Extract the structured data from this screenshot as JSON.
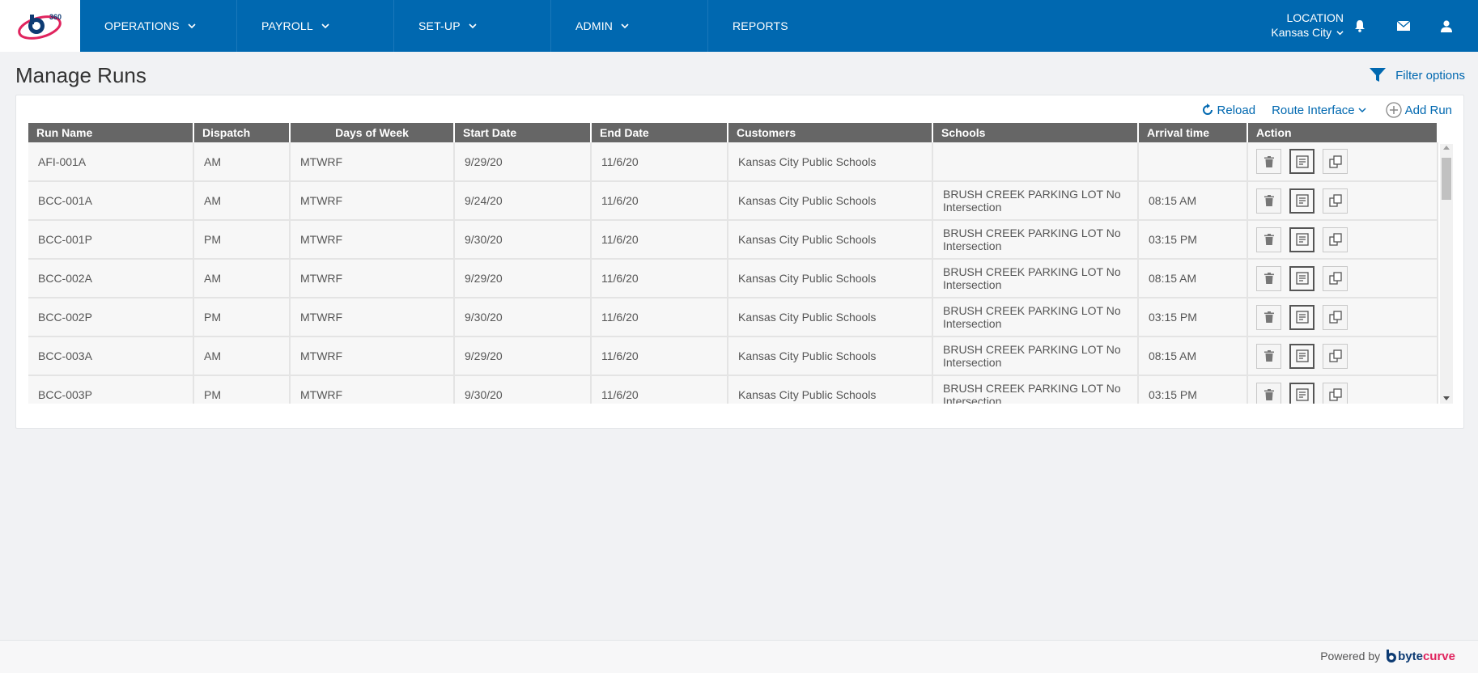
{
  "nav": {
    "logo_text": "360",
    "items": [
      {
        "label": "OPERATIONS",
        "has_dropdown": true
      },
      {
        "label": "PAYROLL",
        "has_dropdown": true
      },
      {
        "label": "SET-UP",
        "has_dropdown": true
      },
      {
        "label": "ADMIN",
        "has_dropdown": true
      },
      {
        "label": "REPORTS",
        "has_dropdown": false
      }
    ],
    "location_label": "LOCATION",
    "location_value": "Kansas City",
    "icons": [
      "bell-icon",
      "envelope-icon",
      "user-icon"
    ]
  },
  "page": {
    "title": "Manage Runs",
    "filter_label": "Filter options"
  },
  "toolbar": {
    "reload_label": "Reload",
    "route_interface_label": "Route Interface",
    "add_run_label": "Add Run"
  },
  "table": {
    "columns": [
      "Run Name",
      "Dispatch",
      "Days of Week",
      "Start Date",
      "End Date",
      "Customers",
      "Schools",
      "Arrival time",
      "Action"
    ],
    "rows": [
      {
        "run_name": "AFI-001A",
        "dispatch": "AM",
        "days": "MTWRF",
        "start": "9/29/20",
        "end": "11/6/20",
        "customer": "Kansas City Public Schools",
        "school": "",
        "arrival": ""
      },
      {
        "run_name": "BCC-001A",
        "dispatch": "AM",
        "days": "MTWRF",
        "start": "9/24/20",
        "end": "11/6/20",
        "customer": "Kansas City Public Schools",
        "school": "BRUSH CREEK PARKING LOT No Intersection",
        "arrival": "08:15 AM"
      },
      {
        "run_name": "BCC-001P",
        "dispatch": "PM",
        "days": "MTWRF",
        "start": "9/30/20",
        "end": "11/6/20",
        "customer": "Kansas City Public Schools",
        "school": "BRUSH CREEK PARKING LOT No Intersection",
        "arrival": "03:15 PM"
      },
      {
        "run_name": "BCC-002A",
        "dispatch": "AM",
        "days": "MTWRF",
        "start": "9/29/20",
        "end": "11/6/20",
        "customer": "Kansas City Public Schools",
        "school": "BRUSH CREEK PARKING LOT No Intersection",
        "arrival": "08:15 AM"
      },
      {
        "run_name": "BCC-002P",
        "dispatch": "PM",
        "days": "MTWRF",
        "start": "9/30/20",
        "end": "11/6/20",
        "customer": "Kansas City Public Schools",
        "school": "BRUSH CREEK PARKING LOT No Intersection",
        "arrival": "03:15 PM"
      },
      {
        "run_name": "BCC-003A",
        "dispatch": "AM",
        "days": "MTWRF",
        "start": "9/29/20",
        "end": "11/6/20",
        "customer": "Kansas City Public Schools",
        "school": "BRUSH CREEK PARKING LOT No Intersection",
        "arrival": "08:15 AM"
      },
      {
        "run_name": "BCC-003P",
        "dispatch": "PM",
        "days": "MTWRF",
        "start": "9/30/20",
        "end": "11/6/20",
        "customer": "Kansas City Public Schools",
        "school": "BRUSH CREEK PARKING LOT No Intersection",
        "arrival": "03:15 PM"
      }
    ],
    "action_icons": [
      "trash-icon",
      "notes-icon",
      "copy-icon"
    ]
  },
  "footer": {
    "powered_by": "Powered by",
    "brand_part1": "byte",
    "brand_part2": "curve"
  },
  "colors": {
    "nav_bg": "#0068b0",
    "header_bg": "#666666",
    "link": "#0068b0",
    "page_bg": "#f1f2f4"
  }
}
